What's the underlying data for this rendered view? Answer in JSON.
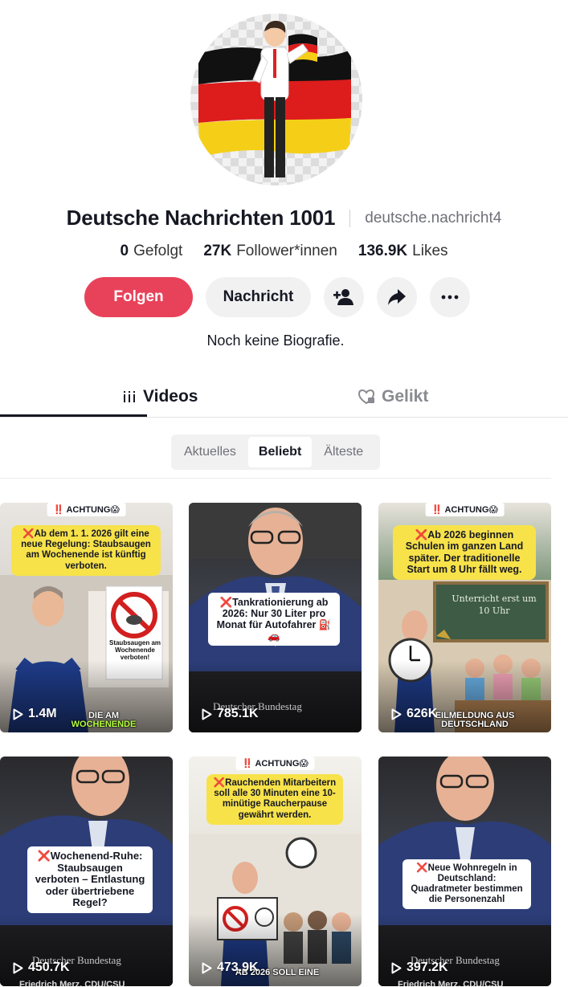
{
  "profile": {
    "name": "Deutsche Nachrichten 1001",
    "handle": "deutsche.nachricht4",
    "bio": "Noch keine Biografie."
  },
  "stats": {
    "following_count": "0",
    "following_label": "Gefolgt",
    "followers_count": "27K",
    "followers_label": "Follower*innen",
    "likes_count": "136.9K",
    "likes_label": "Likes"
  },
  "actions": {
    "follow_label": "Folgen",
    "message_label": "Nachricht",
    "add_friend_icon": "add-user-icon",
    "share_icon": "share-arrow-icon",
    "more_icon": "more-dots-icon"
  },
  "tabs": {
    "videos_label": "Videos",
    "liked_label": "Gelikt"
  },
  "sort": {
    "options": [
      "Aktuelles",
      "Beliebt",
      "Älteste"
    ],
    "selected": "Beliebt"
  },
  "colors": {
    "follow_button": "#e8425a",
    "accent_yellow": "#f7e24a"
  },
  "videos": [
    {
      "views": "1.4M",
      "badge": "‼️ ACHTUNG😱",
      "headline": "❌Ab dem 1. 1. 2026 gilt eine neue Regelung: Staubsaugen am Wochenende ist künftig verboten.",
      "sign_text": "Staubsaugen am Wochenende verboten!",
      "caption_line1": "DIE AM",
      "caption_line2": "WOCHENENDE"
    },
    {
      "views": "785.1K",
      "headline": "❌Tankrationierung ab 2026: Nur 30 Liter pro Monat für Autofahrer ⛽🚗",
      "watermark": "Deutscher Bundestag"
    },
    {
      "views": "626K",
      "badge": "‼️ ACHTUNG😱",
      "headline": "❌Ab 2026 beginnen Schulen im ganzen Land später. Der traditionelle Start um 8 Uhr fällt weg.",
      "board_text": "Unterricht erst um 10 Uhr",
      "caption_line1": "EILMELDUNG AUS",
      "caption_line2": "DEUTSCHLAND"
    },
    {
      "views": "450.7K",
      "headline": "❌Wochenend-Ruhe: Staubsaugen verboten – Entlastung oder übertriebene Regel?",
      "watermark": "Deutscher Bundestag",
      "lower_third": "Friedrich Merz, CDU/CSU"
    },
    {
      "views": "473.9K",
      "badge": "‼️ ACHTUNG😱",
      "headline": "❌Rauchenden Mitarbeitern soll alle 30 Minuten eine 10-minütige Raucherpause gewährt werden.",
      "caption_line1": "AB 2026 SOLL EINE"
    },
    {
      "views": "397.2K",
      "headline": "❌Neue Wohnregeln in Deutschland: Quadratmeter bestimmen die Personenzahl",
      "watermark": "Deutscher Bundestag",
      "lower_third": "Friedrich Merz, CDU/CSU"
    }
  ]
}
